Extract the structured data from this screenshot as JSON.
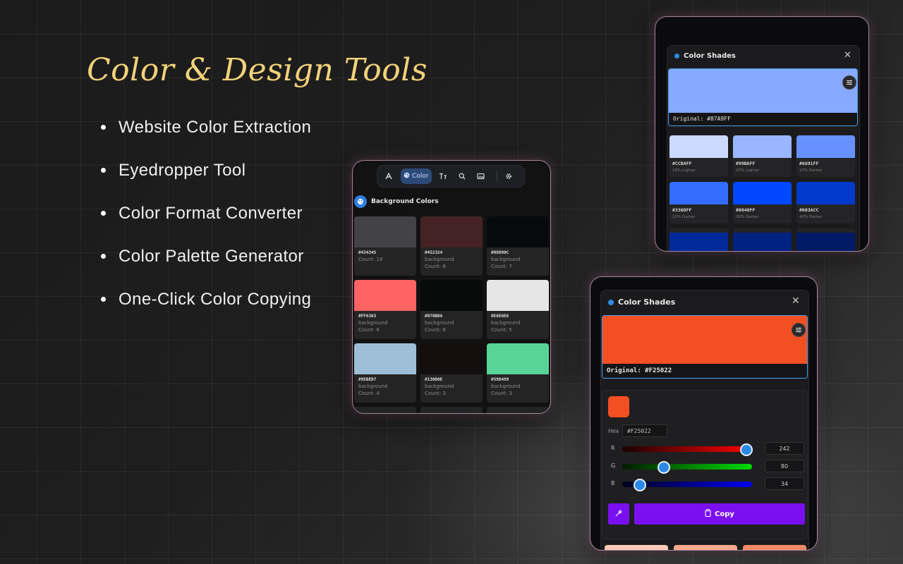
{
  "headline": "Color & Design Tools",
  "features": [
    "Website Color Extraction",
    "Eyedropper Tool",
    "Color Format Converter",
    "Color Palette Generator",
    "One-Click Color Copying"
  ],
  "colors": {
    "headline": "#f3d27a",
    "accent_blue": "#2f8be6",
    "button_purple": "#7a10f0"
  },
  "panel_extract": {
    "toolbar": {
      "active_tab_label": "Color",
      "icons": [
        "font-icon",
        "palette-icon",
        "text-size-icon",
        "search-icon",
        "image-icon",
        "gear-icon"
      ]
    },
    "section_title": "Background Colors",
    "swatches": [
      {
        "hex": "#434345",
        "category": "",
        "count": "Count: 18",
        "color": "#434345"
      },
      {
        "hex": "#452324",
        "category": "background",
        "count": "Count: 8",
        "color": "#452324"
      },
      {
        "hex": "#08090C",
        "category": "background",
        "count": "Count: 7",
        "color": "#08090C"
      },
      {
        "hex": "#FF6363",
        "category": "background",
        "count": "Count: 6",
        "color": "#FF6363"
      },
      {
        "hex": "#070B0A",
        "category": "background",
        "count": "Count: 6",
        "color": "#070B0A"
      },
      {
        "hex": "#E6E6E6",
        "category": "background",
        "count": "Count: 5",
        "color": "#E6E6E6"
      },
      {
        "hex": "#9EBED7",
        "category": "background",
        "count": "Count: 4",
        "color": "#9EBED7"
      },
      {
        "hex": "#130D0E",
        "category": "background",
        "count": "Count: 3",
        "color": "#130D0E"
      },
      {
        "hex": "#59D499",
        "category": "background",
        "count": "Count: 3",
        "color": "#59D499"
      }
    ]
  },
  "panel_shades_blue": {
    "title": "Color Shades",
    "original_label": "Original: #87A9FF",
    "base_color": "#87A9FF",
    "shades": [
      {
        "hex": "#CCDAFF",
        "label": "10% Lighter",
        "color": "#CCDAFF"
      },
      {
        "hex": "#99B6FF",
        "label": "00% Lighter",
        "color": "#99B6FF"
      },
      {
        "hex": "#6691FF",
        "label": "10% Darker",
        "color": "#6691FF"
      },
      {
        "hex": "#336DFF",
        "label": "20% Darker",
        "color": "#336DFF"
      },
      {
        "hex": "#0048FF",
        "label": "30% Darker",
        "color": "#0048FF"
      },
      {
        "hex": "#003ACC",
        "label": "40% Darker",
        "color": "#003ACC"
      }
    ],
    "peek_colors": [
      "#002a99",
      "#002280",
      "#001a66"
    ]
  },
  "panel_shades_orange": {
    "title": "Color Shades",
    "original_label": "Original: #F25022",
    "base_color": "#F25022",
    "editor": {
      "hex_label": "Hex",
      "hex_value": "#F25022",
      "channels": [
        {
          "label": "R",
          "value": "242",
          "fraction": 0.949,
          "gradient": "linear-gradient(90deg,#1a0000,#ff0000)"
        },
        {
          "label": "G",
          "value": "80",
          "fraction": 0.314,
          "gradient": "linear-gradient(90deg,#001a00,#00dd00)"
        },
        {
          "label": "B",
          "value": "34",
          "fraction": 0.133,
          "gradient": "linear-gradient(90deg,#00001a,#0000ee)"
        }
      ],
      "copy_label": "Copy"
    },
    "peek_colors": [
      "#fbcbb8",
      "#f7a98d",
      "#f38a66"
    ]
  }
}
